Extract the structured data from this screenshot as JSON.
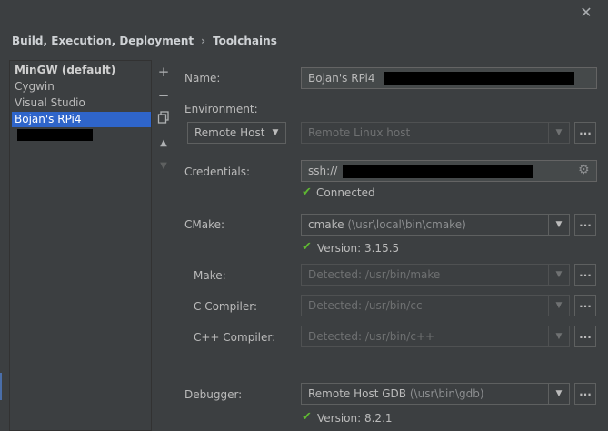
{
  "window": {
    "close_icon": "close-icon"
  },
  "breadcrumb": {
    "parent": "Build, Execution, Deployment",
    "separator": "›",
    "current": "Toolchains"
  },
  "toolchains": {
    "items": [
      {
        "label": "MinGW (default)"
      },
      {
        "label": "Cygwin"
      },
      {
        "label": "Visual Studio"
      },
      {
        "label": "Bojan's RPi4"
      }
    ],
    "toolbar": {
      "add": "+",
      "remove": "−",
      "copy_icon": "copy-icon",
      "up": "▲",
      "down": "▼"
    }
  },
  "form": {
    "name": {
      "label": "Name:",
      "value": "Bojan's RPi4"
    },
    "environment": {
      "label": "Environment:",
      "type_value": "Remote Host",
      "host_placeholder": "Remote Linux host",
      "more": "..."
    },
    "credentials": {
      "label": "Credentials:",
      "value": "ssh://",
      "status": "Connected"
    },
    "cmake": {
      "label": "CMake:",
      "value": "cmake",
      "path": "(\\usr\\local\\bin\\cmake)",
      "status": "Version: 3.15.5",
      "more": "..."
    },
    "make": {
      "label": "Make:",
      "value": "Detected: /usr/bin/make",
      "more": "..."
    },
    "c_compiler": {
      "label": "C Compiler:",
      "value": "Detected: /usr/bin/cc",
      "more": "..."
    },
    "cpp_compiler": {
      "label": "C++ Compiler:",
      "value": "Detected: /usr/bin/c++",
      "more": "..."
    },
    "debugger": {
      "label": "Debugger:",
      "value": "Remote Host GDB",
      "path": "(\\usr\\bin\\gdb)",
      "status": "Version: 8.2.1",
      "more": "..."
    }
  }
}
